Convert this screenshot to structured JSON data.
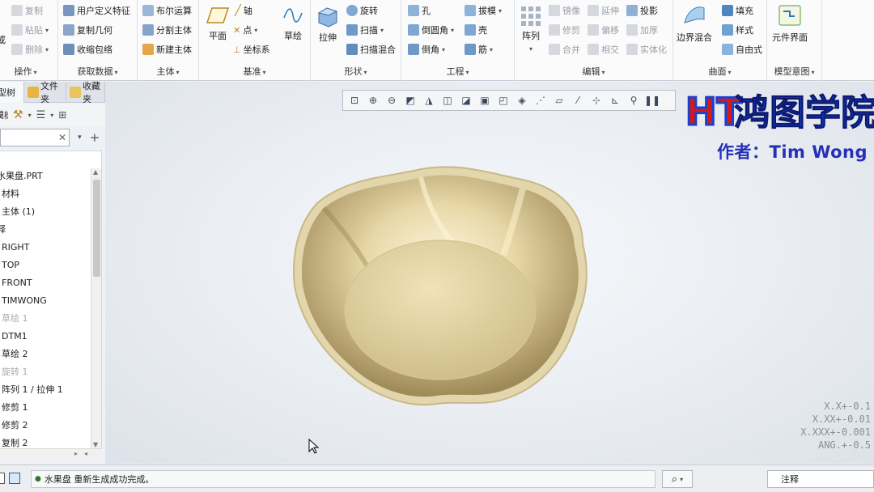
{
  "ribbon": {
    "ops": {
      "title": "操作",
      "item_partial": "或",
      "copy": "复制",
      "paste": "粘贴",
      "delete": "删除"
    },
    "getdata": {
      "title": "获取数据",
      "udf": "用户定义特征",
      "copygeom": "复制几何",
      "shrinkwrap": "收缩包络"
    },
    "body": {
      "title": "主体",
      "boolean": "布尔运算",
      "split": "分割主体",
      "newbody": "新建主体"
    },
    "datum": {
      "title": "基准",
      "plane": "平面",
      "axis": "轴",
      "point": "点",
      "csys": "坐标系",
      "sketch": "草绘"
    },
    "shapes": {
      "title": "形状",
      "extrude": "拉伸",
      "revolve": "旋转",
      "sweep": "扫描",
      "sweptblend": "扫描混合"
    },
    "engineering": {
      "title": "工程",
      "hole": "孔",
      "round": "倒圆角",
      "chamfer": "倒角",
      "draft": "拔模",
      "shell": "壳",
      "rib": "筋"
    },
    "editing": {
      "title": "编辑",
      "pattern": "阵列",
      "mirror": "镜像",
      "trim": "修剪",
      "merge": "合并",
      "extend": "延伸",
      "offset": "偏移",
      "intersect": "相交",
      "project": "投影",
      "thicken": "加厚",
      "solidify": "实体化"
    },
    "surfaces": {
      "title": "曲面",
      "boundary": "边界混合",
      "fill": "填充",
      "style": "样式",
      "freestyle": "自由式"
    },
    "intent": {
      "title": "模型意图",
      "component": "元件界面"
    }
  },
  "panel": {
    "tabs": [
      "模型树",
      "文件夹",
      "收藏夹"
    ],
    "tree_label": "模树",
    "search_value": ""
  },
  "tree": [
    {
      "label": "水果盘.PRT",
      "dim": false
    },
    {
      "label": "材料",
      "dim": false
    },
    {
      "label": "主体 (1)",
      "dim": false
    },
    {
      "label": "释",
      "dim": false
    },
    {
      "label": "RIGHT",
      "dim": false
    },
    {
      "label": "TOP",
      "dim": false
    },
    {
      "label": "FRONT",
      "dim": false
    },
    {
      "label": "TIMWONG",
      "dim": false
    },
    {
      "label": "草绘 1",
      "dim": true
    },
    {
      "label": "DTM1",
      "dim": false
    },
    {
      "label": "草绘 2",
      "dim": false
    },
    {
      "label": "旋转 1",
      "dim": true
    },
    {
      "label": "阵列 1 / 拉伸 1",
      "dim": false
    },
    {
      "label": "修剪 1",
      "dim": false
    },
    {
      "label": "修剪 2",
      "dim": false
    },
    {
      "label": "复制 2",
      "dim": false
    }
  ],
  "viewport": {
    "logo_text": "鸿图学院",
    "logo_mark": "HT",
    "author": "作者：Tim Wong",
    "tolerances": [
      "X.X+-0.1",
      "X.XX+-0.01",
      "X.XXX+-0.001",
      "ANG.+-0.5"
    ]
  },
  "status": {
    "message": "水果盘 重新生成成功完成。",
    "filter": "注释"
  },
  "colors": {
    "accent": "#2b5fa8",
    "bowl": "#d8c79a",
    "logo_blue": "#1c3fd0",
    "logo_red": "#d11b1b"
  }
}
